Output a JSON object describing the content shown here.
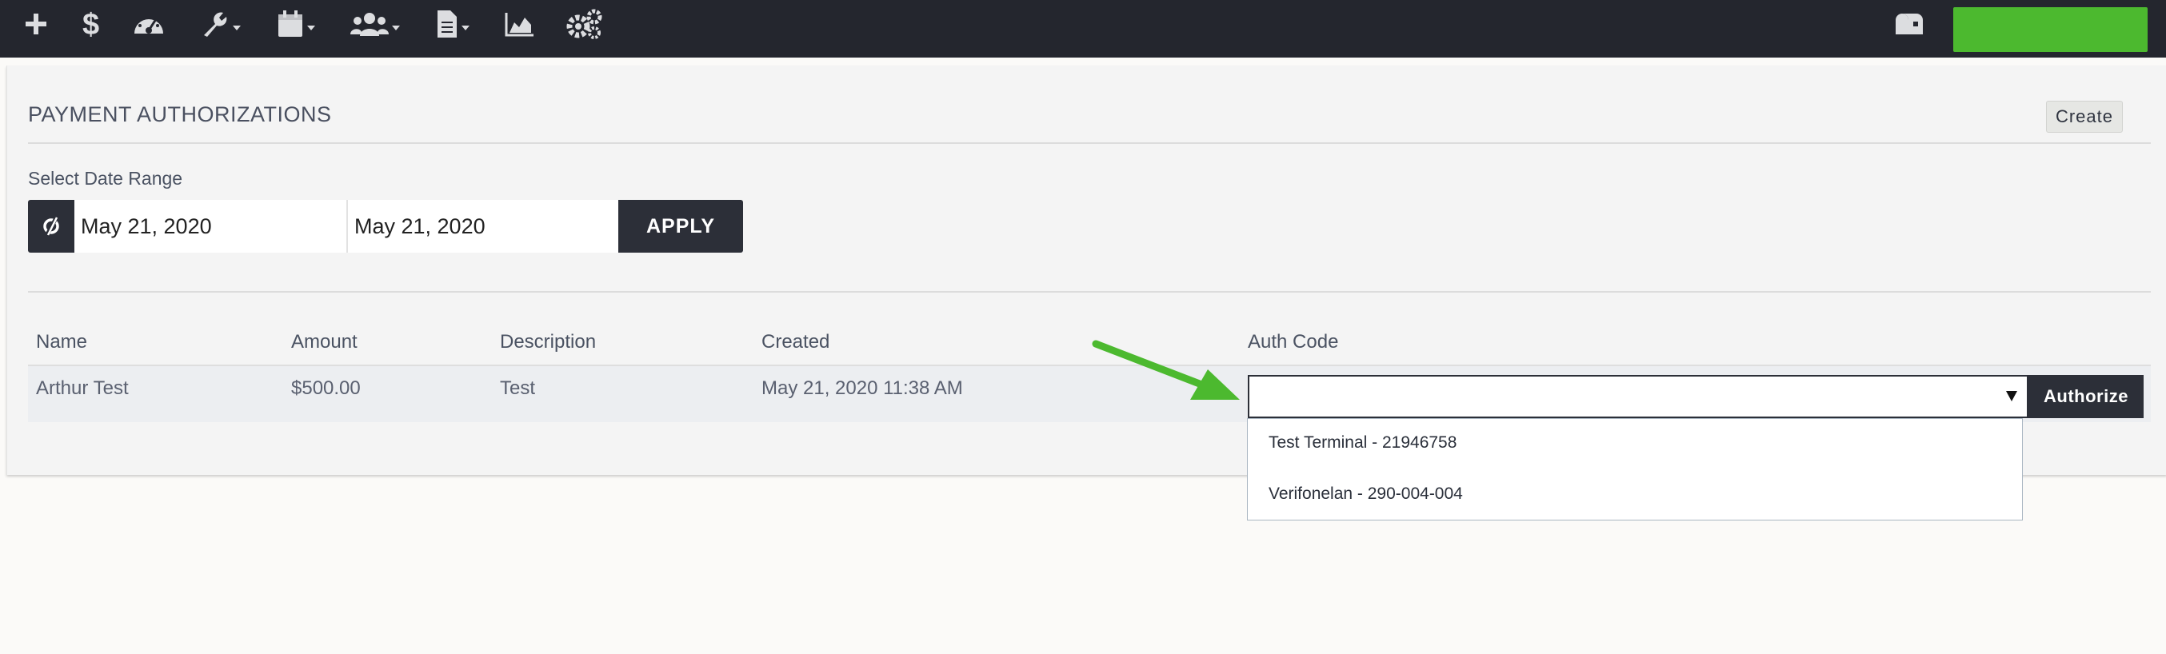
{
  "nav": {
    "icons": [
      "plus-icon",
      "dollar-icon",
      "dashboard-icon",
      "wrench-icon",
      "calendar-icon",
      "users-icon",
      "document-icon",
      "chart-icon",
      "gears-icon",
      "mailbox-icon"
    ],
    "accent": "#4cb92f"
  },
  "page": {
    "title": "PAYMENT AUTHORIZATIONS",
    "create_label": "Create"
  },
  "filter": {
    "label": "Select Date Range",
    "start_date": "May 21, 2020",
    "end_date": "May 21, 2020",
    "apply_label": "APPLY"
  },
  "table": {
    "columns": [
      "Name",
      "Amount",
      "Description",
      "Created",
      "Auth Code"
    ],
    "rows": [
      {
        "name": "Arthur Test",
        "amount": "$500.00",
        "description": "Test",
        "created": "May 21, 2020 11:38 AM",
        "auth_code": ""
      }
    ],
    "authorize_label": "Authorize"
  },
  "dropdown": {
    "options": [
      "Test Terminal - 21946758",
      "Verifonelan - 290-004-004"
    ]
  },
  "colors": {
    "topbar": "#24262e",
    "dark_button": "#2c2f38",
    "annotation_arrow": "#4cb92f"
  }
}
